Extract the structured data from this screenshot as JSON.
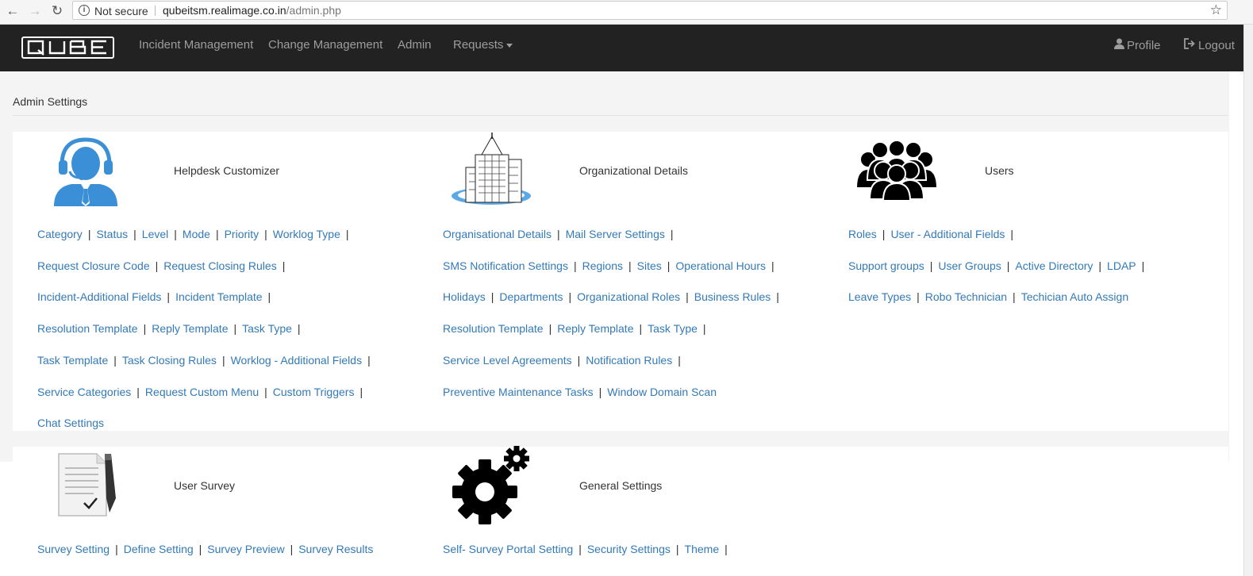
{
  "browser": {
    "security_label": "Not secure",
    "url_host": "qubeitsm.realimage.co.in",
    "url_path": "/admin.php"
  },
  "navbar": {
    "logo_text": "QUBE",
    "items": [
      "Incident Management",
      "Change Management",
      "Admin",
      "Requests"
    ],
    "profile": "Profile",
    "logout": "Logout"
  },
  "page": {
    "title": "Admin Settings"
  },
  "sections": {
    "helpdesk": {
      "title": "Helpdesk Customizer",
      "rows": [
        [
          "Category",
          "Status",
          "Level",
          "Mode",
          "Priority",
          "Worklog Type"
        ],
        [
          "Request Closure Code",
          "Request Closing Rules"
        ],
        [
          "Incident-Additional Fields",
          "Incident Template"
        ],
        [
          "Resolution Template",
          "Reply Template",
          "Task Type"
        ],
        [
          "Task Template",
          "Task Closing Rules",
          "Worklog - Additional Fields"
        ],
        [
          "Service Categories",
          "Request Custom Menu",
          "Custom Triggers"
        ],
        [
          "Chat Settings"
        ]
      ],
      "trailing_pipe": [
        true,
        true,
        true,
        true,
        true,
        true,
        false
      ]
    },
    "organizational": {
      "title": "Organizational Details",
      "rows": [
        [
          "Organisational Details",
          "Mail Server Settings"
        ],
        [
          "SMS Notification Settings",
          "Regions",
          "Sites",
          "Operational Hours"
        ],
        [
          "Holidays",
          "Departments",
          "Organizational Roles",
          "Business Rules"
        ],
        [
          "Resolution Template",
          "Reply Template",
          "Task Type"
        ],
        [
          "Service Level Agreements",
          "Notification Rules"
        ],
        [
          "Preventive Maintenance Tasks",
          "Window Domain Scan"
        ]
      ],
      "trailing_pipe": [
        true,
        true,
        true,
        true,
        true,
        false
      ]
    },
    "users": {
      "title": "Users",
      "rows": [
        [
          "Roles",
          "User - Additional Fields"
        ],
        [
          "Support groups",
          "User Groups",
          "Active Directory",
          "LDAP"
        ],
        [
          "Leave Types",
          "Robo Technician",
          "Techician Auto Assign"
        ]
      ],
      "trailing_pipe": [
        true,
        true,
        false
      ]
    },
    "survey": {
      "title": "User Survey",
      "rows": [
        [
          "Survey Setting",
          "Define Setting",
          "Survey Preview",
          "Survey Results"
        ]
      ],
      "trailing_pipe": [
        false
      ]
    },
    "general": {
      "title": "General Settings",
      "rows": [
        [
          "Self- Survey Portal Setting",
          "Security Settings",
          "Theme"
        ]
      ],
      "trailing_pipe": [
        true
      ]
    }
  },
  "icons": {
    "helpdesk": "headset-agent-icon",
    "organizational": "building-icon",
    "users": "users-group-icon",
    "survey": "survey-document-icon",
    "general": "gears-icon"
  },
  "colors": {
    "link": "#337ab7",
    "navbar": "#222222",
    "nav_text": "#9d9d9d",
    "icon_blue": "#3a8fd6"
  }
}
